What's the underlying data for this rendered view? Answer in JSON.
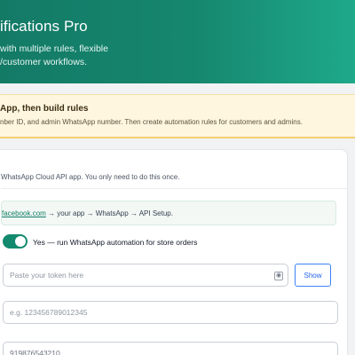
{
  "hero": {
    "title": "ifications Pro",
    "subtitle_line1": "with multiple rules, flexible",
    "subtitle_line2": "/customer workflows."
  },
  "notice": {
    "title": "App, then build rules",
    "text": "nber ID, and admin WhatsApp number. Then create automation rules for customers and admins."
  },
  "card": {
    "description": "WhatsApp Cloud API app. You only need to do this once.",
    "help_link": "facebook.com",
    "help_path": " → your app → WhatsApp → API Setup.",
    "toggle_label": "Yes — run WhatsApp automation for store orders",
    "toggle_on": true,
    "token": {
      "placeholder": "Paste your token here",
      "value": ""
    },
    "show_button": "Show",
    "phone_id": {
      "placeholder": "e.g. 123456789012345",
      "value": ""
    },
    "admin_number": {
      "placeholder": "919876543210",
      "value": ""
    }
  },
  "colors": {
    "accent": "#138a6e",
    "notice_bg": "#fff6e0",
    "link": "#0f7d64",
    "show_button": "#2563eb"
  },
  "icons": {
    "token_field_icon": "eye-icon"
  }
}
